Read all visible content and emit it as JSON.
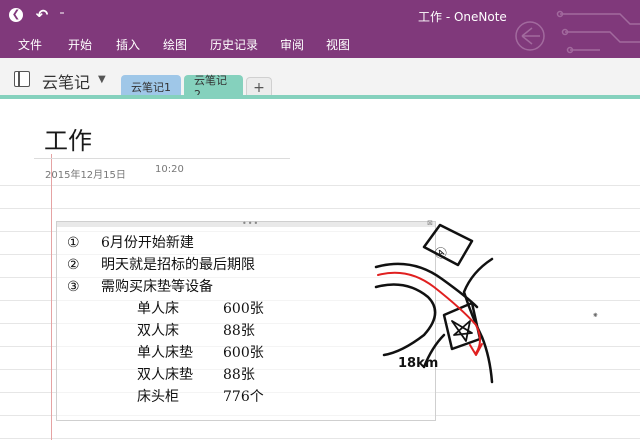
{
  "window": {
    "title": "工作 - OneNote"
  },
  "icons": {
    "back": "back-circle-icon",
    "undo": "undo-icon",
    "quick_access": "quick-access-dropdown-icon",
    "notebook": "notebook-icon",
    "notebook_dropdown": "chevron-down-icon"
  },
  "ribbon": {
    "tabs": [
      "文件",
      "开始",
      "插入",
      "绘图",
      "历史记录",
      "审阅",
      "视图"
    ]
  },
  "notebook": {
    "name": "云笔记",
    "sections": [
      "云笔记1",
      "云笔记2"
    ],
    "add_section": "+"
  },
  "page": {
    "title": "工作",
    "date": "2015年12月15日",
    "time": "10:20"
  },
  "note": {
    "lines": [
      {
        "num": "①",
        "text": "6月份开始新建"
      },
      {
        "num": "②",
        "text": "明天就是招标的最后期限"
      },
      {
        "num": "③",
        "text": "需购买床垫等设备"
      }
    ],
    "items": [
      {
        "name": "单人床",
        "qty": "600张"
      },
      {
        "name": "双人床",
        "qty": "88张"
      },
      {
        "name": "单人床垫",
        "qty": "600张"
      },
      {
        "name": "双人床垫",
        "qty": "88张"
      },
      {
        "name": "床头柜",
        "qty": "776个"
      }
    ]
  },
  "sketch": {
    "label_top": "Ⓐ",
    "label_distance": "18km"
  },
  "colors": {
    "ribbon": "#80397b",
    "section1": "#9fc7e8",
    "section2": "#85d1bd",
    "margin": "#e5a3a3",
    "route": "#e02020"
  }
}
